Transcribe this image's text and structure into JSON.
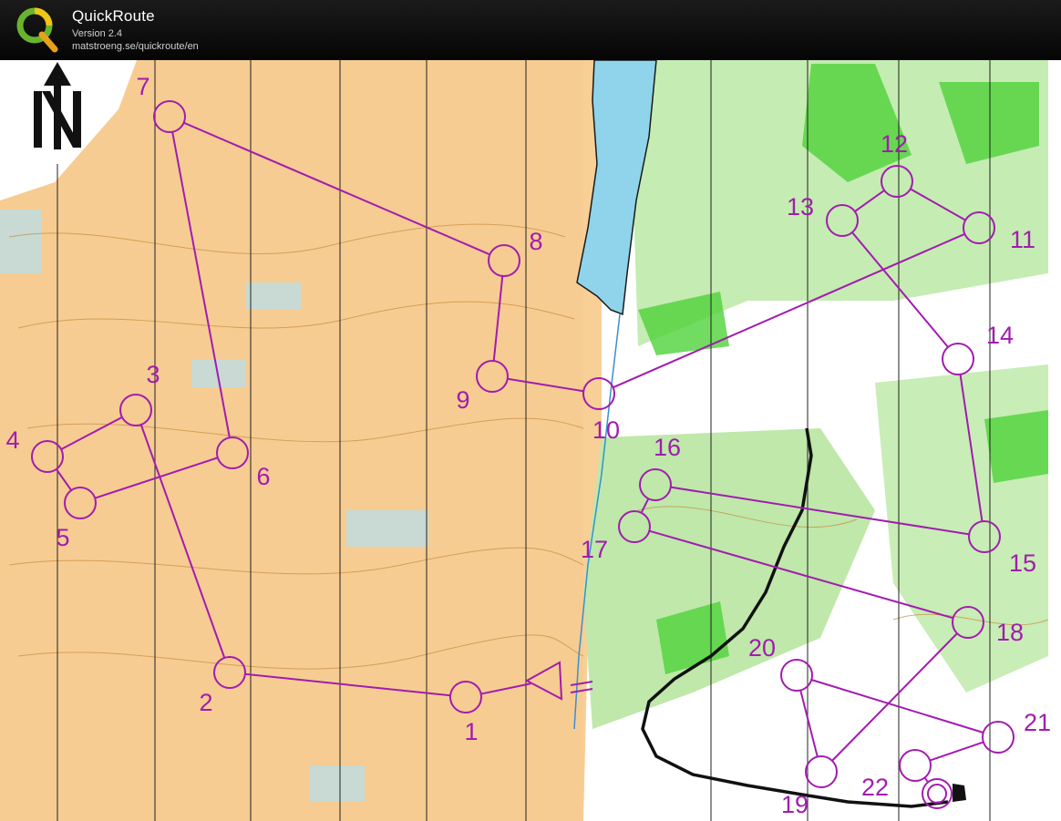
{
  "app": {
    "title": "QuickRoute",
    "version": "Version 2.4",
    "url": "matstroeng.se/quickroute/en"
  },
  "map": {
    "course_color": "#a21caf",
    "north_arrow": "north-arrow-icon",
    "start": "start-triangle-icon",
    "finish": "finish-double-circle-icon",
    "controls": [
      {
        "label": "1"
      },
      {
        "label": "2"
      },
      {
        "label": "3"
      },
      {
        "label": "4"
      },
      {
        "label": "5"
      },
      {
        "label": "6"
      },
      {
        "label": "7"
      },
      {
        "label": "8"
      },
      {
        "label": "9"
      },
      {
        "label": "10"
      },
      {
        "label": "11"
      },
      {
        "label": "12"
      },
      {
        "label": "13"
      },
      {
        "label": "14"
      },
      {
        "label": "15"
      },
      {
        "label": "16"
      },
      {
        "label": "17"
      },
      {
        "label": "18"
      },
      {
        "label": "19"
      },
      {
        "label": "20"
      },
      {
        "label": "21"
      },
      {
        "label": "22"
      }
    ]
  }
}
